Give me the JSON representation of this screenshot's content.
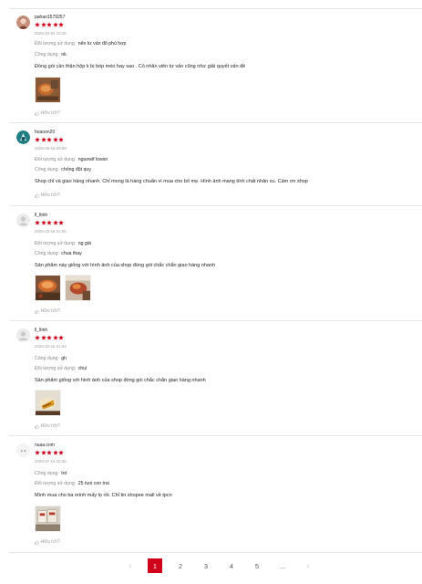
{
  "accent": "#d0011b",
  "star_color": "#d0011b",
  "reviews": [
    {
      "username": "pahao1579257",
      "rating": 5,
      "date": "2025-10-04 10:26",
      "attr1_label": "Đối tượng sử dụng:",
      "attr1_value": "nên tư vấn đổ phù hợp",
      "attr2_label": "Công dụng:",
      "attr2_value": "ok",
      "comment": "Đóng gói cần thận hộp k bị bóp méo hay sao . Có nhân viên tư vấn cũng như giải quyết vấn đề",
      "helpful": "Hữu ích?"
    },
    {
      "username": "hoaoon20",
      "rating": 5,
      "date": "2025-09-16 09:59",
      "attr1_label": "Đối tượng sử dụng:",
      "attr1_value": "nguowif lowsn",
      "attr2_label": "Công dụng:",
      "attr2_value": "chống đột quỵ",
      "comment": "Shop chỉ và giao hàng nhanh. Chỉ mong là hàng chuẩn vì mua cho bố mẹ. Hình ảnh mang tính chất nhân xu. Cảm ơn shop",
      "helpful": "Hữu ích?"
    },
    {
      "username": "ll_ltinh",
      "rating": 5,
      "date": "2025-10-16 21:05",
      "attr1_label": "Đối tượng sử dụng:",
      "attr1_value": "ng già",
      "attr2_label": "Công dụng:",
      "attr2_value": "chua thay",
      "comment": "Sản phẩm này giống với hình ảnh của shop đóng gói chắc chắn giao hàng nhanh",
      "helpful": "Hữu ích?"
    },
    {
      "username": "ll_ltinh",
      "rating": 5,
      "date": "2025-10-16 21:04",
      "attr1_label": "Công dụng:",
      "attr1_value": "gh",
      "attr2_label": "Đối tượng sử dụng:",
      "attr2_value": "chui",
      "comment": "Sản phẩm giống với hình ảnh của shop đóng gói chắc chắn giao hàng nhanh",
      "helpful": "Hữu ích?"
    },
    {
      "username": "nuaa.com",
      "rating": 5,
      "date": "2025-07-12 22:45",
      "attr1_label": "Công dụng:",
      "attr1_value": "tot",
      "attr2_label": "Đối tượng sử dụng:",
      "attr2_value": "25 tuoi con trai",
      "comment": "Mình mua cho ba mình mấy lọ rồi. Chỉ tin shopee mall về tpcn",
      "helpful": "Hữu ích?"
    }
  ],
  "pagination": {
    "prev": "‹",
    "pages": [
      "1",
      "2",
      "3",
      "4",
      "5",
      "..."
    ],
    "next": "›",
    "active": "1"
  },
  "icons": {
    "star": "star-icon",
    "thumb": "thumbs-up-icon",
    "avatar": "user-avatar-icon"
  }
}
